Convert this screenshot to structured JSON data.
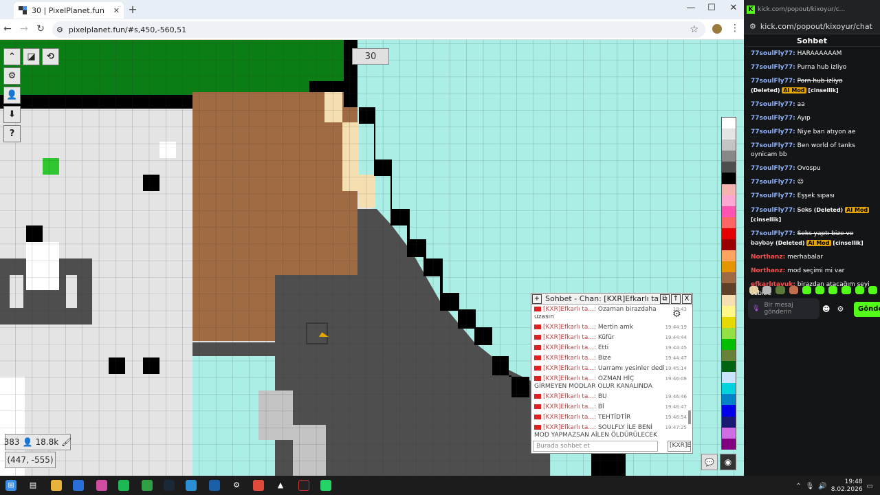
{
  "browser": {
    "tab_title": "30 | PixelPlanet.fun",
    "tab_close": "✕",
    "new_tab": "+",
    "url": "pixelplanet.fun/#s,450,-560,51",
    "win_min": "—",
    "win_max": "☐",
    "win_close": "✕",
    "back": "←",
    "forward": "→",
    "reload": "↻",
    "star": "☆",
    "menu": "⋮"
  },
  "canvas": {
    "counter": "30",
    "online": "383",
    "pixels": "18.8k",
    "coords": "(447, -555)"
  },
  "palette": [
    "#ffffff",
    "#e4e4e4",
    "#c4c4c4",
    "#888888",
    "#4e4e4e",
    "#000000",
    "#f4b3ae",
    "#ffa7d1",
    "#ff54b2",
    "#ff6565",
    "#e50000",
    "#9a0000",
    "#fea460",
    "#e59500",
    "#a06a42",
    "#604028",
    "#f5dfb0",
    "#fff889",
    "#e5d900",
    "#94e044",
    "#02be01",
    "#688338",
    "#006513",
    "#cae3ff",
    "#00d3dd",
    "#0083c7",
    "#0000ea",
    "#191973",
    "#cf6ee4",
    "#820080"
  ],
  "pixelchat": {
    "title": "Sohbet - Chan: [KXR]Efkarlı tavu",
    "btn_add": "+",
    "btn_popout": "⧉",
    "btn_up": "↑",
    "btn_close": "X",
    "placeholder": "Burada sohbet et",
    "select": "[KXR]E",
    "gear": "⚙",
    "messages": [
      {
        "nick": "[KXR]Efkarlı ta...:",
        "text": "Ozaman birazdaha uzasın",
        "time": "19:43"
      },
      {
        "nick": "[KXR]Efkarlı ta...:",
        "text": "Mertin amk",
        "time": "19:44:19"
      },
      {
        "nick": "[KXR]Efkarlı ta...:",
        "text": "Küfür",
        "time": "19:44:44"
      },
      {
        "nick": "[KXR]Efkarlı ta...:",
        "text": "Etti",
        "time": "19:44:45"
      },
      {
        "nick": "[KXR]Efkarlı ta...:",
        "text": "Bize",
        "time": "19:44:47"
      },
      {
        "nick": "[KXR]Efkarlı ta...:",
        "text": "Uarramı yesinler dedi",
        "time": "19:45:14"
      },
      {
        "nick": "[KXR]Efkarlı ta...:",
        "text": "OZMAN HİÇ GİRMEYEN MODLAR OLUR KANALINDA",
        "time": "19:46:08"
      },
      {
        "nick": "[KXR]Efkarlı ta...:",
        "text": "BU",
        "time": "19:46:46"
      },
      {
        "nick": "[KXR]Efkarlı ta...:",
        "text": "Bİ",
        "time": "19:46:47"
      },
      {
        "nick": "[KXR]Efkarlı ta...:",
        "text": "TEHTİDTİR",
        "time": "19:46:54"
      },
      {
        "nick": "[KXR]Efkarlı ta...:",
        "text": "SOULFLY İLE BENİ MOD YAPMAZSAN AİLEN ÖLDÜRÜLECEK",
        "time": "19:47:25"
      }
    ]
  },
  "kick": {
    "window_title": "kick.com/popout/kixoyur/c...",
    "url": "kick.com/popout/kixoyur/chat",
    "header": "Sohbet",
    "input_placeholder": "Bir mesaj gönderin",
    "send": "Gönder",
    "messages": [
      {
        "user": "77soulFly77:",
        "text": "HARAAAAAAM",
        "color": "#8fb4ff"
      },
      {
        "user": "77soulFly77:",
        "text": "Purna hub izliyo",
        "color": "#8fb4ff"
      },
      {
        "user": "77soulFly77:",
        "deleted": "Porn hub izliyo",
        "note": "(Deleted)",
        "mod": "AI Mod",
        "tag": "[cinsellik]",
        "color": "#8fb4ff"
      },
      {
        "user": "77soulFly77:",
        "text": "aa",
        "color": "#8fb4ff"
      },
      {
        "user": "77soulFly77:",
        "text": "Ayıp",
        "color": "#8fb4ff"
      },
      {
        "user": "77soulFly77:",
        "text": "Niye ban atıyon ae",
        "color": "#8fb4ff"
      },
      {
        "user": "77soulFly77:",
        "text": "Ben world of tanks oynicam bb",
        "color": "#8fb4ff"
      },
      {
        "user": "77soulFly77:",
        "text": "Ovospu",
        "color": "#8fb4ff"
      },
      {
        "user": "77soulFly77:",
        "text": "😐",
        "color": "#8fb4ff"
      },
      {
        "user": "77soulFly77:",
        "text": "Eşşek sıpası",
        "color": "#8fb4ff"
      },
      {
        "user": "77soulFly77:",
        "deleted": "Seks",
        "note": "(Deleted)",
        "mod": "AI Mod",
        "tag": "[cinsellik]",
        "color": "#8fb4ff"
      },
      {
        "user": "77soulFly77:",
        "deleted": "Seks yaptı bize ve baybay",
        "note": "(Deleted)",
        "mod": "AI Mod",
        "tag": "[cinsellik]",
        "color": "#8fb4ff"
      },
      {
        "user": "Northanz:",
        "text": "merhabalar",
        "color": "#ff4d4d"
      },
      {
        "user": "Northanz:",
        "text": "mod seçimi mi var",
        "color": "#ff4d4d"
      },
      {
        "user": "efkarlıtavuk:",
        "text": "birazdan atacağım şeyi sabitle",
        "color": "#ff4d4d"
      }
    ]
  },
  "taskbar": {
    "time": "19:48",
    "date": "8.02.2026"
  }
}
